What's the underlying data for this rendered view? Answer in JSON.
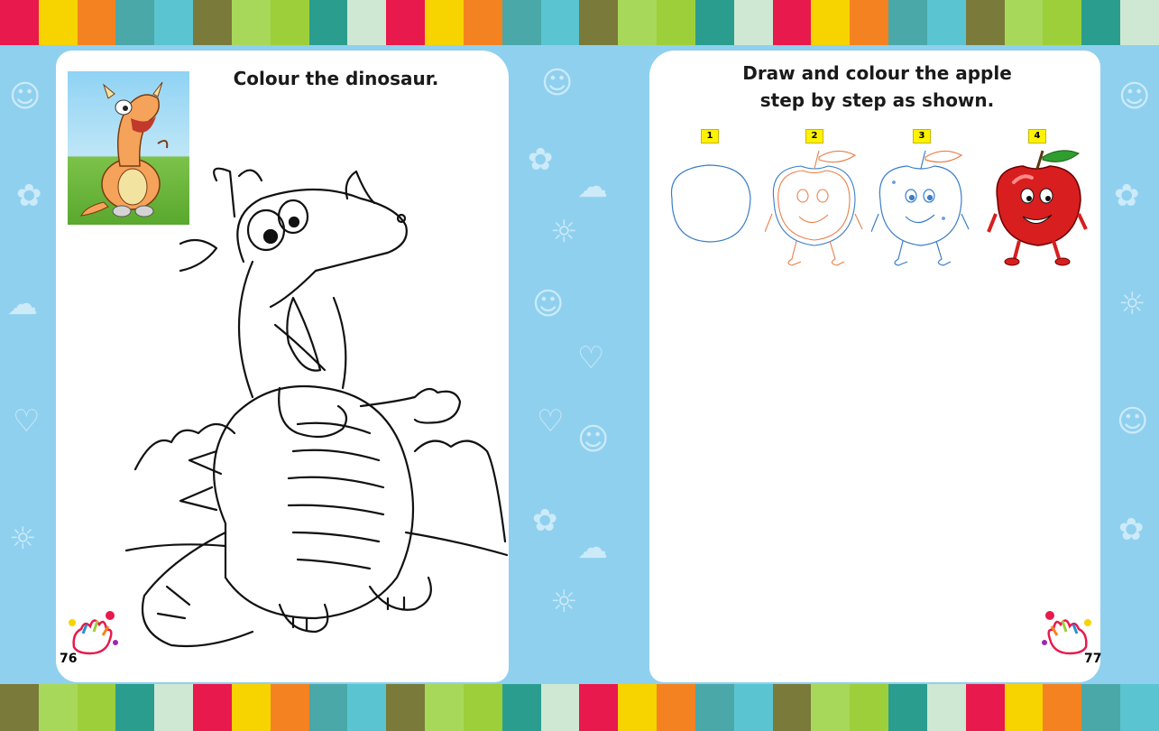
{
  "left_page": {
    "title": "Colour the dinosaur.",
    "page_number": "76"
  },
  "right_page": {
    "title_line1": "Draw and colour the apple",
    "title_line2": "step by step as shown.",
    "steps": [
      {
        "label": "1"
      },
      {
        "label": "2"
      },
      {
        "label": "3"
      },
      {
        "label": "4"
      }
    ],
    "page_number": "77"
  },
  "colors": {
    "background_blue": "#8fd0ef",
    "page_white": "#ffffff",
    "apple_red": "#d81e1e",
    "leaf_green": "#2f9e2f",
    "step_badge": "#fff200",
    "stripe_palette": [
      "#e8194c",
      "#9dcf3a",
      "#5bc4d1",
      "#f7d300",
      "#2a9d8f",
      "#7a7a3a",
      "#f58220",
      "#cfe8d4",
      "#a8d85a",
      "#4aa8a8"
    ]
  },
  "icons": {
    "handprint": "handprint-icon",
    "dinosaur": "dinosaur-outline",
    "apple": "apple-character"
  }
}
